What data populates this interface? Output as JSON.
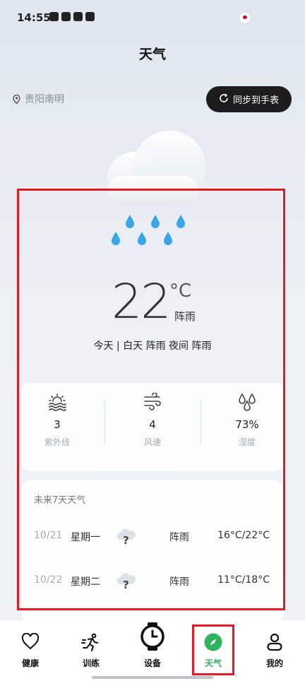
{
  "status_bar": {
    "time": "14:55"
  },
  "header": {
    "title": "天气"
  },
  "location": {
    "name": "贵阳南明"
  },
  "sync_button": {
    "label": "同步到手表"
  },
  "current": {
    "temperature": "22",
    "unit": "°C",
    "condition": "阵雨",
    "today_summary": "今天 | 白天 阵雨 夜间 阵雨"
  },
  "stats": [
    {
      "icon": "uv-sun-icon",
      "value": "3",
      "label": "紫外线"
    },
    {
      "icon": "wind-icon",
      "value": "4",
      "label": "风速"
    },
    {
      "icon": "humidity-drops-icon",
      "value": "73%",
      "label": "湿度"
    }
  ],
  "forecast": {
    "title": "未来7天天气",
    "days": [
      {
        "date": "10/21",
        "weekday": "星期一",
        "icon": "unknown-weather-icon",
        "condition": "阵雨",
        "range": "16°C/22°C"
      },
      {
        "date": "10/22",
        "weekday": "星期二",
        "icon": "unknown-weather-icon",
        "condition": "阵雨",
        "range": "11°C/18°C"
      }
    ]
  },
  "bottom_nav": {
    "items": [
      {
        "label": "健康",
        "icon": "heart-icon"
      },
      {
        "label": "训练",
        "icon": "running-icon"
      },
      {
        "label": "设备",
        "icon": "watch-icon"
      },
      {
        "label": "天气",
        "icon": "compass-icon",
        "active": true
      },
      {
        "label": "我的",
        "icon": "person-icon"
      }
    ]
  },
  "colors": {
    "accent": "#2db35e",
    "highlight": "#e11b22",
    "rain": "#3aa6e8",
    "dark_button": "#1d1d1f"
  }
}
